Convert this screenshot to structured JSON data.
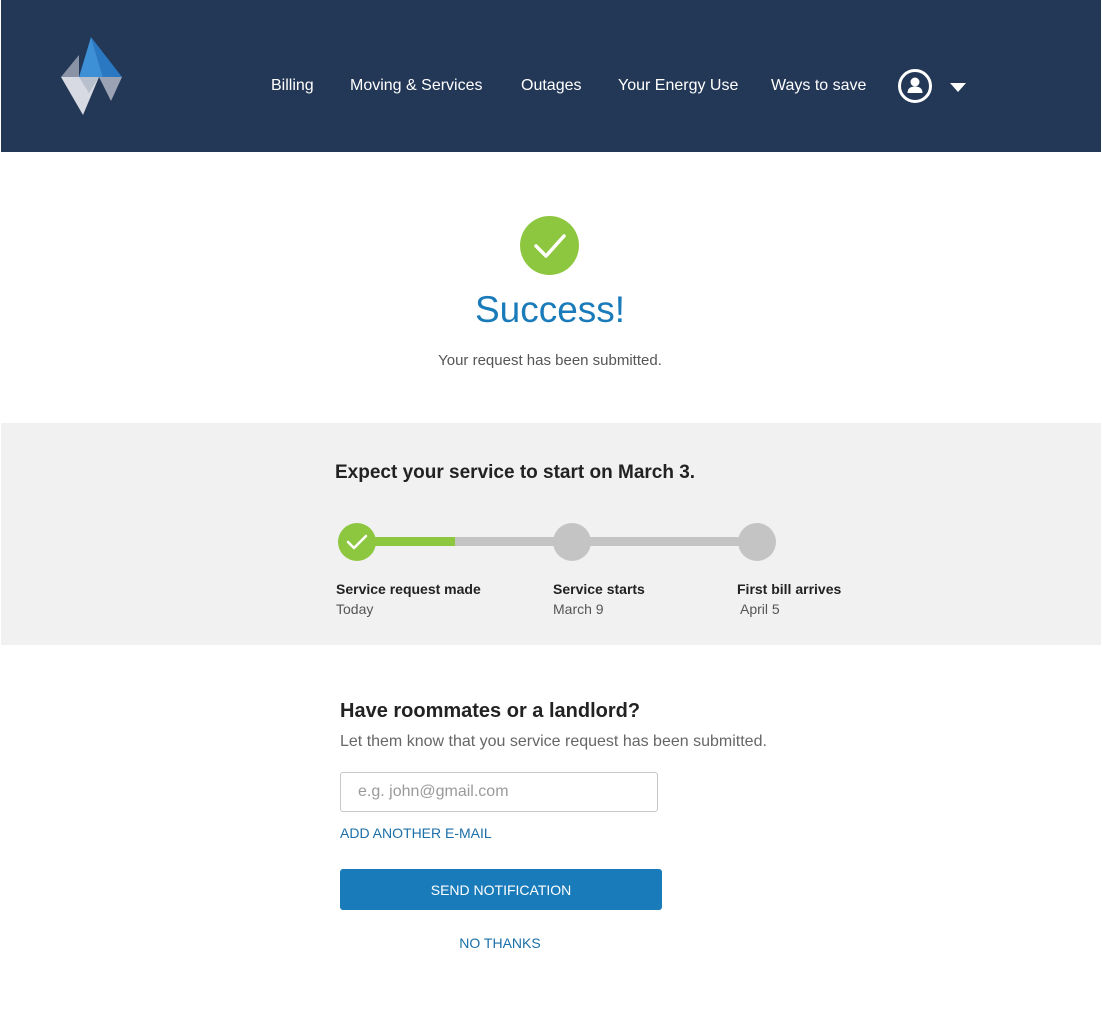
{
  "header": {
    "logo_icon": "diamond-logo-icon",
    "nav": [
      {
        "label": "Billing"
      },
      {
        "label": "Moving & Services"
      },
      {
        "label": "Outages"
      },
      {
        "label": "Your Energy Use"
      },
      {
        "label": "Ways to save"
      }
    ],
    "account_icon": "user-circle-icon",
    "dropdown_icon": "caret-down-icon"
  },
  "success": {
    "icon": "check-circle-icon",
    "title": "Success!",
    "subtitle": "Your request has been submitted."
  },
  "timeline": {
    "heading": "Expect your service to start on March 3.",
    "progress": 0.5,
    "steps": [
      {
        "label": "Service request made",
        "date": "Today",
        "status": "done"
      },
      {
        "label": "Service starts",
        "date": "March 9",
        "status": "pending"
      },
      {
        "label": "First bill arrives",
        "date": "April 5",
        "status": "pending"
      }
    ]
  },
  "notify": {
    "heading": "Have roommates or a landlord?",
    "subtitle": "Let them know that you service request has been submitted.",
    "email_placeholder": "e.g. john@gmail.com",
    "email_value": "",
    "add_email_label": "ADD ANOTHER E-MAIL",
    "send_label": "SEND NOTIFICATION",
    "no_thanks_label": "NO THANKS"
  },
  "colors": {
    "header_bg": "#233756",
    "accent_blue": "#1a7bba",
    "success_green": "#8dc63f",
    "panel_bg": "#f1f1f1",
    "inactive_gray": "#c4c4c4"
  }
}
